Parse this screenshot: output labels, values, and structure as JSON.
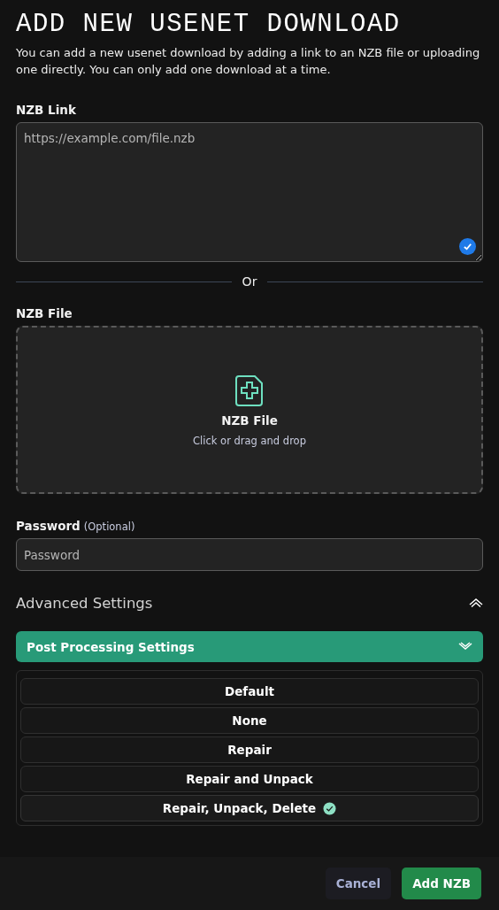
{
  "title": "ADD NEW USENET DOWNLOAD",
  "description": "You can add a new usenet download by adding a link to an NZB file or uploading one directly. You can only add one download at a time.",
  "nzb_link": {
    "label": "NZB Link",
    "placeholder": "https://example.com/file.nzb",
    "verified": true
  },
  "divider": "Or",
  "nzb_file": {
    "label": "NZB File",
    "title": "NZB File",
    "hint": "Click or drag and drop"
  },
  "password": {
    "label": "Password",
    "note": "(Optional)",
    "placeholder": "Password"
  },
  "advanced": {
    "title": "Advanced Settings",
    "expanded": true
  },
  "post_processing": {
    "title": "Post Processing Settings",
    "expanded": true,
    "options": [
      {
        "label": "Default",
        "selected": false
      },
      {
        "label": "None",
        "selected": false
      },
      {
        "label": "Repair",
        "selected": false
      },
      {
        "label": "Repair and Unpack",
        "selected": false
      },
      {
        "label": "Repair, Unpack, Delete",
        "selected": true
      }
    ]
  },
  "buttons": [
    {
      "label": "Cancel",
      "kind": "secondary"
    },
    {
      "label": "Add NZB",
      "kind": "primary"
    }
  ]
}
